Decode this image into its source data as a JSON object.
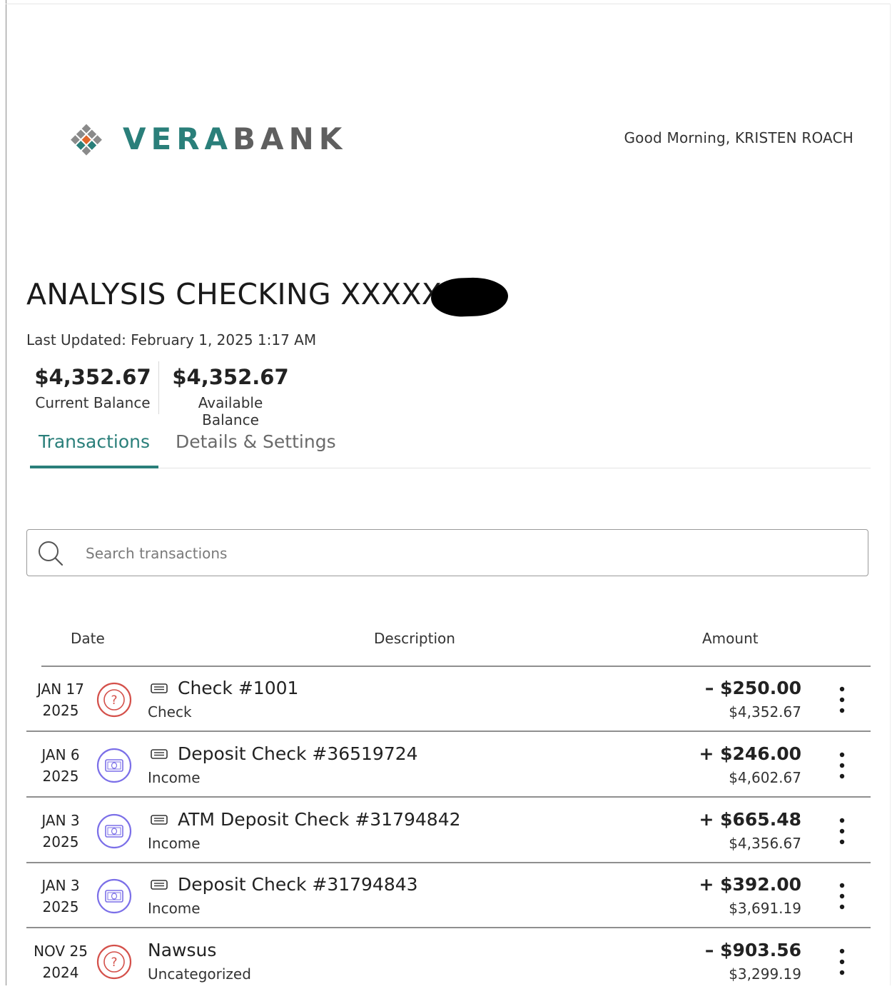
{
  "brand": {
    "name_part1": "VERA",
    "name_part2": "BANK",
    "colors": {
      "teal": "#2a7f7a",
      "gray": "#5f5f5f",
      "orange": "#e0662a",
      "red": "#d4504a",
      "purple": "#7b6fe8"
    }
  },
  "header": {
    "greeting": "Good Morning, KRISTEN ROACH"
  },
  "account": {
    "title": "ANALYSIS CHECKING XXXXXX",
    "last_updated": "Last Updated: February 1, 2025 1:17 AM",
    "current_balance": "$4,352.67",
    "current_balance_label": "Current Balance",
    "available_balance": "$4,352.67",
    "available_balance_label": "Available Balance"
  },
  "tabs": [
    {
      "label": "Transactions",
      "active": true
    },
    {
      "label": "Details & Settings",
      "active": false
    }
  ],
  "search": {
    "placeholder": "Search transactions",
    "icon": "search-icon"
  },
  "table": {
    "columns": {
      "date": "Date",
      "description": "Description",
      "amount": "Amount"
    },
    "rows": [
      {
        "date": "JAN 17",
        "year": "2025",
        "category_icon": "question-icon",
        "has_check_icon": true,
        "description": "Check #1001",
        "category": "Check",
        "amount": "– $250.00",
        "balance": "$4,352.67"
      },
      {
        "date": "JAN 6",
        "year": "2025",
        "category_icon": "money-icon",
        "has_check_icon": true,
        "description": "Deposit Check #36519724",
        "category": "Income",
        "amount": "+ $246.00",
        "balance": "$4,602.67"
      },
      {
        "date": "JAN 3",
        "year": "2025",
        "category_icon": "money-icon",
        "has_check_icon": true,
        "description": "ATM Deposit Check #31794842",
        "category": "Income",
        "amount": "+ $665.48",
        "balance": "$4,356.67"
      },
      {
        "date": "JAN 3",
        "year": "2025",
        "category_icon": "money-icon",
        "has_check_icon": true,
        "description": "Deposit Check #31794843",
        "category": "Income",
        "amount": "+ $392.00",
        "balance": "$3,691.19"
      },
      {
        "date": "NOV 25",
        "year": "2024",
        "category_icon": "question-icon",
        "has_check_icon": false,
        "description": "Nawsus",
        "category": "Uncategorized",
        "amount": "– $903.56",
        "balance": "$3,299.19"
      }
    ]
  }
}
